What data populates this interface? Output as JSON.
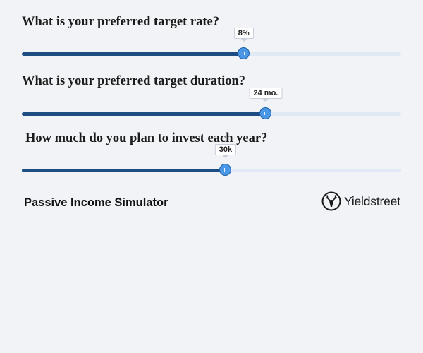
{
  "sliders": [
    {
      "question": "What is your preferred target rate?",
      "value_label": "8%",
      "position_pct": 58.5
    },
    {
      "question": "What is your preferred target duration?",
      "value_label": "24 mo.",
      "position_pct": 64.3
    },
    {
      "question": "How much do you plan to invest each year?",
      "value_label": "30k",
      "position_pct": 53.7
    }
  ],
  "footer": {
    "title": "Passive Income Simulator",
    "brand_name": "Yieldstreet",
    "brand_icon": "stag-logo-icon"
  },
  "colors": {
    "background": "#f1f3f7",
    "fill": "#1e4d84",
    "track": "#dfe8f4",
    "thumb": "#4a97e6"
  }
}
